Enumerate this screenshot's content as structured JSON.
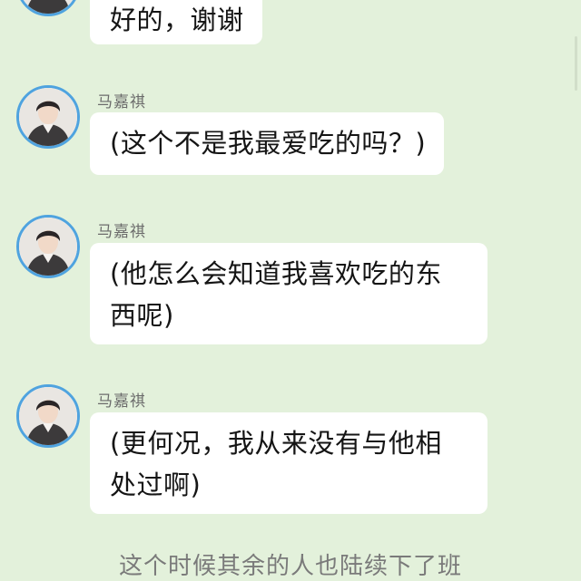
{
  "messages": [
    {
      "sender": "",
      "text": "好的，谢谢"
    },
    {
      "sender": "马嘉祺",
      "text": "(这个不是我最爱吃的吗？)"
    },
    {
      "sender": "马嘉祺",
      "text": "(他怎么会知道我喜欢吃的东\n西呢)"
    },
    {
      "sender": "马嘉祺",
      "text": "(更何况，我从来没有与他相\n处过啊)"
    }
  ],
  "narration": "这个时候其余的人也陆续下了班",
  "colors": {
    "background": "#e3f1db",
    "bubble": "#ffffff",
    "avatar_ring": "#4fa3df"
  }
}
